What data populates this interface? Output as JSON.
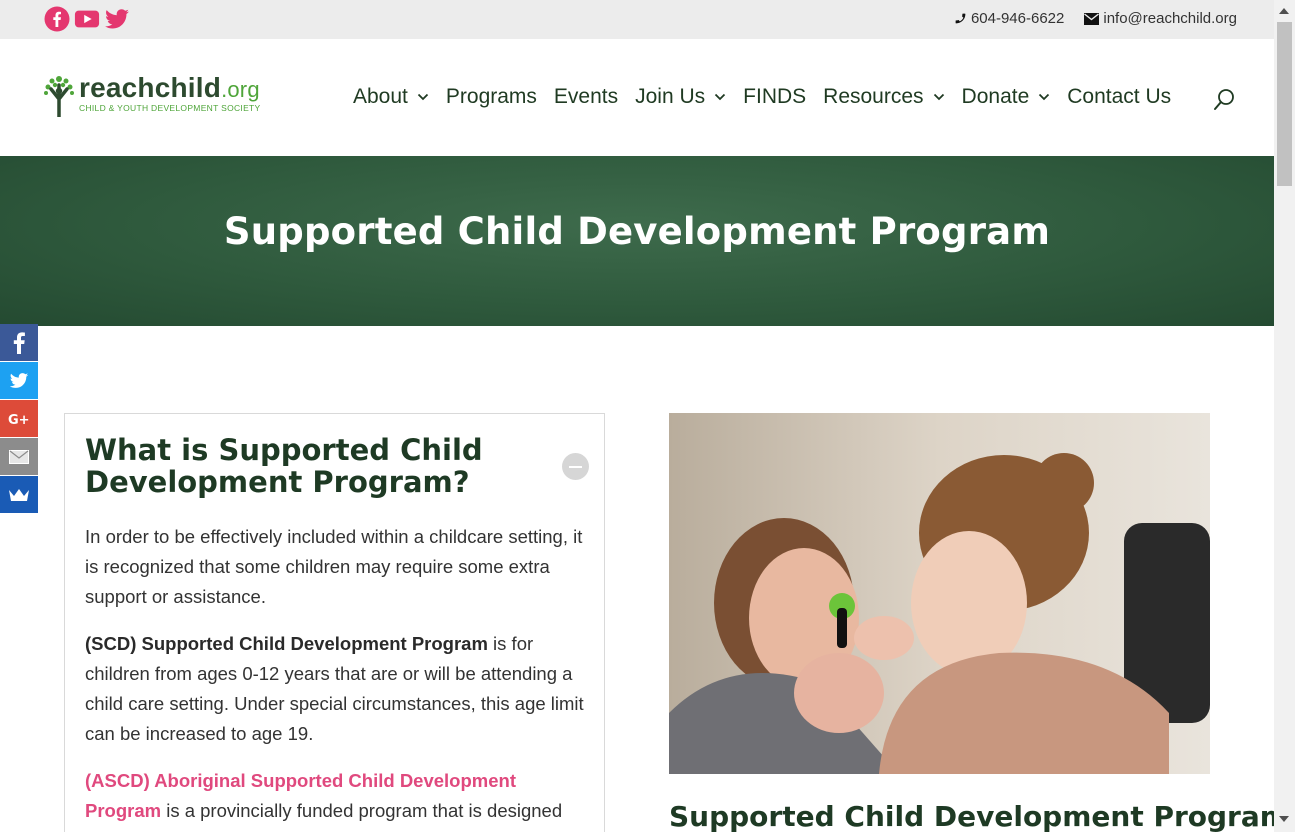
{
  "topbar": {
    "social": [
      {
        "name": "facebook-icon",
        "color": "#e4376f"
      },
      {
        "name": "youtube-icon",
        "color": "#e4376f"
      },
      {
        "name": "twitter-icon",
        "color": "#e4376f"
      }
    ],
    "phone": "604-946-6622",
    "email": "info@reachchild.org"
  },
  "logo": {
    "main_a": "reach",
    "main_b": "child",
    "main_c": ".org",
    "sub": "CHILD & YOUTH DEVELOPMENT SOCIETY"
  },
  "nav": {
    "items": [
      {
        "label": "About",
        "dropdown": true
      },
      {
        "label": "Programs",
        "dropdown": false
      },
      {
        "label": "Events",
        "dropdown": false
      },
      {
        "label": "Join Us",
        "dropdown": true
      },
      {
        "label": "FINDS",
        "dropdown": false
      },
      {
        "label": "Resources",
        "dropdown": true
      },
      {
        "label": "Donate",
        "dropdown": true
      },
      {
        "label": "Contact Us",
        "dropdown": false
      }
    ]
  },
  "hero": {
    "title": "Supported Child Development Program"
  },
  "share": [
    {
      "name": "facebook-share",
      "color": "#3b5998"
    },
    {
      "name": "twitter-share",
      "color": "#1da1f2"
    },
    {
      "name": "google-plus-share",
      "color": "#dd4b39"
    },
    {
      "name": "email-share",
      "color": "#8c8c8c"
    },
    {
      "name": "sumome-share",
      "color": "#1a5bb5"
    }
  ],
  "accordion": {
    "title": "What is Supported Child Development Program?",
    "p1": "In order to be effectively included within a childcare setting, it is recognized that some children may require some extra support or assistance.",
    "p2_bold": "(SCD) Supported Child Development Program",
    "p2_rest": " is for children from ages 0-12 years that are or will be attending a child care setting. Under special circumstances, this age limit can be increased to age 19.",
    "p3_pink": "(ASCD) Aboriginal Supported Child Development Program",
    "p3_rest": "  is a provincially funded program that is designed specifically to meet the needs of children, families"
  },
  "section_title": "Supported Child Development Program",
  "colors": {
    "brand_green": "#2f5a3d",
    "accent_pink": "#e0497e",
    "text_dark_green": "#1e3a24"
  }
}
